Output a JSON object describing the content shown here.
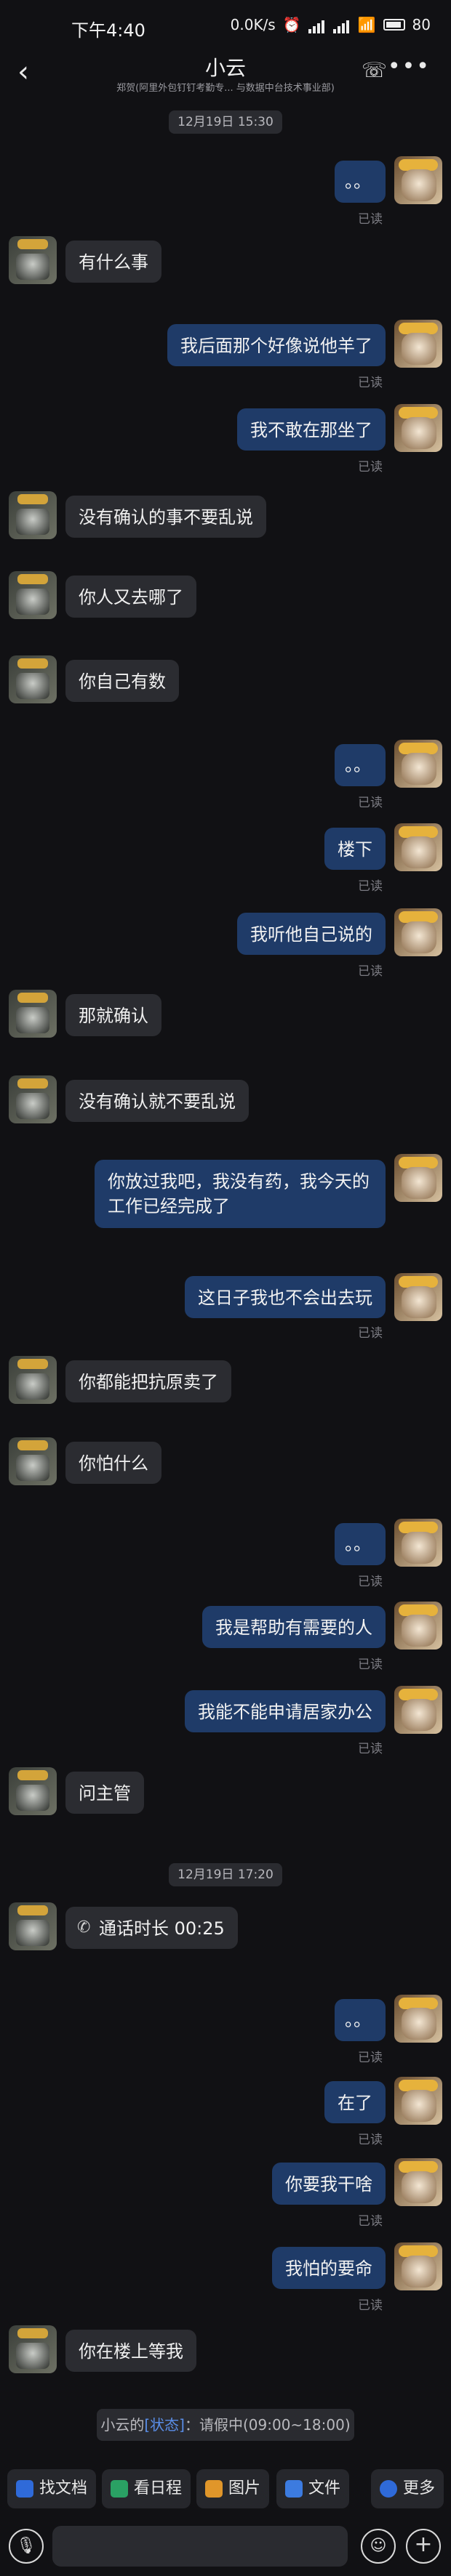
{
  "status_bar": {
    "time": "下午4:40",
    "network": "0.0K/s",
    "battery": "80"
  },
  "header": {
    "title": "小云",
    "subtitle": "郑贺(阿里外包钉钉考勤专...  与数据中台技术事业部)"
  },
  "timestamps": {
    "t1": "12月19日 15:30",
    "t2": "12月19日 17:20"
  },
  "read_label": "已读",
  "messages": [
    "。。",
    "有什么事",
    "我后面那个好像说他羊了",
    "我不敢在那坐了",
    "没有确认的事不要乱说",
    "你人又去哪了",
    "你自己有数",
    "。。",
    "楼下",
    "我听他自己说的",
    "那就确认",
    "没有确认就不要乱说",
    "你放过我吧，我没有药，我今天的",
    "工作已经完成了",
    "这日子我也不会出去玩",
    "你都能把抗原卖了",
    "你怕什么",
    "。。",
    "我是帮助有需要的人",
    "我能不能申请居家办公",
    "问主管",
    "通话时长 00:25",
    "。。",
    "在了",
    "你要我干啥",
    "我怕的要命",
    "你在楼上等我"
  ],
  "notice": {
    "prefix": "小云的",
    "link": "[状态]",
    "suffix": "：请假中(09:00~18:00)"
  },
  "quick_actions": [
    "找文档",
    "看日程",
    "图片",
    "文件",
    "更多"
  ],
  "colors": {
    "bubble_right": "#1f3b68",
    "bubble_left": "#2b2c31",
    "background": "#111114"
  }
}
